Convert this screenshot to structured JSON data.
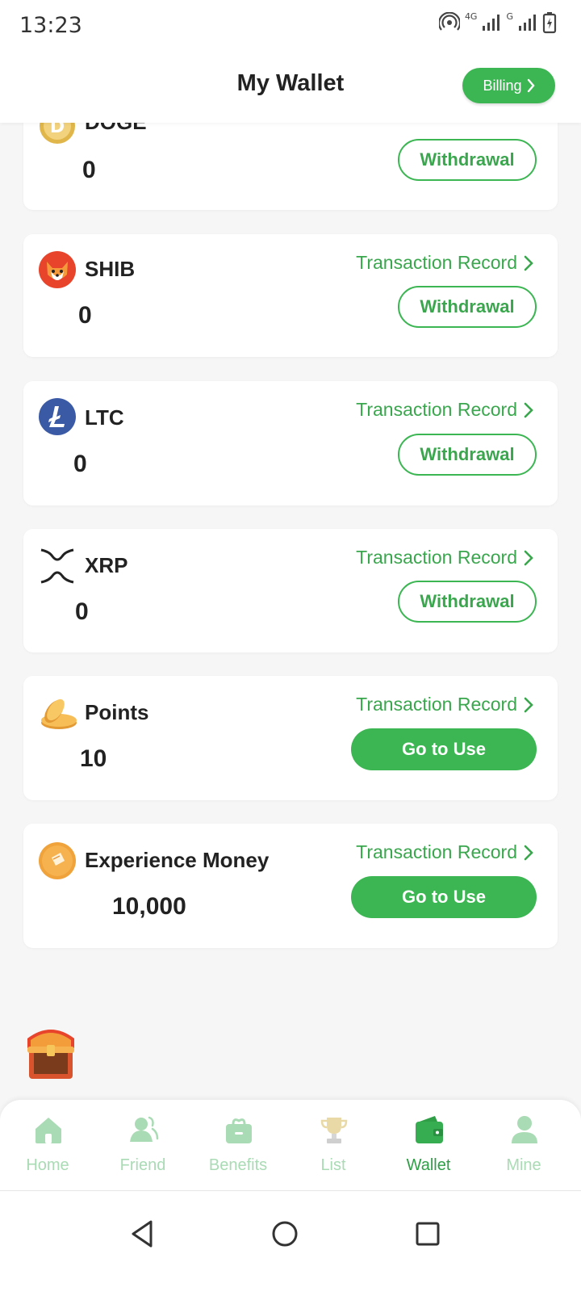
{
  "status_bar": {
    "time": "13:23",
    "network_label_1": "4G",
    "network_label_2": "G"
  },
  "header": {
    "title": "My Wallet",
    "billing_label": "Billing"
  },
  "cards": [
    {
      "id": "doge",
      "name": "DOGE",
      "amount": "0",
      "action": "Withdrawal",
      "action_style": "outline",
      "icon": "doge-coin-icon"
    },
    {
      "id": "shib",
      "name": "SHIB",
      "amount": "0",
      "tx_label": "Transaction Record",
      "action": "Withdrawal",
      "action_style": "outline",
      "icon": "shib-coin-icon"
    },
    {
      "id": "ltc",
      "name": "LTC",
      "amount": "0",
      "tx_label": "Transaction Record",
      "action": "Withdrawal",
      "action_style": "outline",
      "icon": "ltc-coin-icon"
    },
    {
      "id": "xrp",
      "name": "XRP",
      "amount": "0",
      "tx_label": "Transaction Record",
      "action": "Withdrawal",
      "action_style": "outline",
      "icon": "xrp-coin-icon"
    },
    {
      "id": "points",
      "name": "Points",
      "amount": "10",
      "tx_label": "Transaction Record",
      "action": "Go to Use",
      "action_style": "solid",
      "icon": "points-coins-icon"
    },
    {
      "id": "experience",
      "name": "Experience Money",
      "amount": "10,000",
      "tx_label": "Transaction Record",
      "action": "Go to Use",
      "action_style": "solid",
      "icon": "experience-money-icon"
    }
  ],
  "bottom_nav": {
    "items": [
      {
        "label": "Home",
        "icon": "home-icon",
        "active": false
      },
      {
        "label": "Friend",
        "icon": "friend-icon",
        "active": false
      },
      {
        "label": "Benefits",
        "icon": "benefits-icon",
        "active": false
      },
      {
        "label": "List",
        "icon": "trophy-icon",
        "active": false
      },
      {
        "label": "Wallet",
        "icon": "wallet-icon",
        "active": true
      },
      {
        "label": "Mine",
        "icon": "profile-icon",
        "active": false
      }
    ]
  },
  "colors": {
    "accent": "#3cb653",
    "accent_text": "#3aa64d",
    "inactive_nav": "#a9dbb4",
    "background": "#f6f6f6"
  }
}
